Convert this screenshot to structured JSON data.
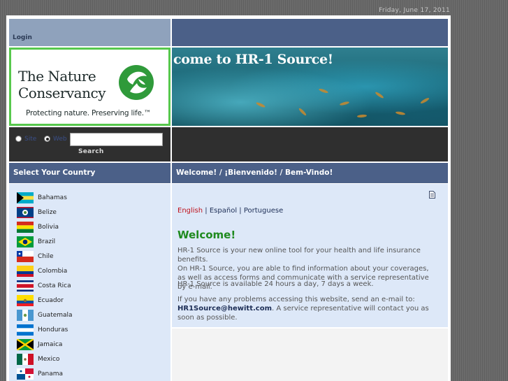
{
  "date": "Friday, June 17, 2011",
  "header": {
    "login_label": "Login"
  },
  "logo": {
    "line1": "The Nature",
    "line2": "Conservancy",
    "tagline": "Protecting nature. Preserving life.™"
  },
  "banner": {
    "title": "come to HR-1 Source!"
  },
  "search": {
    "option1": "Site",
    "option2": "Web",
    "value": "",
    "button_label": "Search"
  },
  "countries": {
    "header": "Select Your Country",
    "items": [
      {
        "label": "Bahamas",
        "flag": "bahamas"
      },
      {
        "label": "Belize",
        "flag": "belize"
      },
      {
        "label": "Bolivia",
        "flag": "bolivia"
      },
      {
        "label": "Brazil",
        "flag": "brazil"
      },
      {
        "label": "Chile",
        "flag": "chile"
      },
      {
        "label": "Colombia",
        "flag": "colombia"
      },
      {
        "label": "Costa Rica",
        "flag": "costa-rica"
      },
      {
        "label": "Ecuador",
        "flag": "ecuador"
      },
      {
        "label": "Guatemala",
        "flag": "guatemala"
      },
      {
        "label": "Honduras",
        "flag": "honduras"
      },
      {
        "label": "Jamaica",
        "flag": "jamaica"
      },
      {
        "label": "Mexico",
        "flag": "mexico"
      },
      {
        "label": "Panama",
        "flag": "panama"
      }
    ]
  },
  "content": {
    "header": "Welcome! / ¡Bienvenido! / Bem-Vindo!",
    "languages": {
      "english": "English",
      "separator": "|",
      "spanish": "Español",
      "portuguese": "Portuguese"
    },
    "welcome_title": "Welcome!",
    "para1": "HR-1 Source is your new online tool for your health and life insurance benefits.",
    "para2": "On HR-1 Source, you are able to find information about your coverages, as well as access forms and communicate with a service representative by e-mail.",
    "para3": "HR-1 Source is available 24 hours a day, 7 days a week.",
    "para4_pre": "If you have any problems accessing this website, send an e-mail to:",
    "email": "HR1Source@hewitt.com",
    "para4_post": ". A service representative will contact you as soon as possible."
  },
  "icons": {
    "print": "document-icon",
    "logo": "leaf-globe-icon"
  },
  "colors": {
    "header_blue": "#4b6088",
    "login_bar": "#8fa2bc",
    "panel_bg": "#dde8f8",
    "logo_green": "#57c84d",
    "welcome_green": "#1f8a1f",
    "english_red": "#c0121c"
  }
}
